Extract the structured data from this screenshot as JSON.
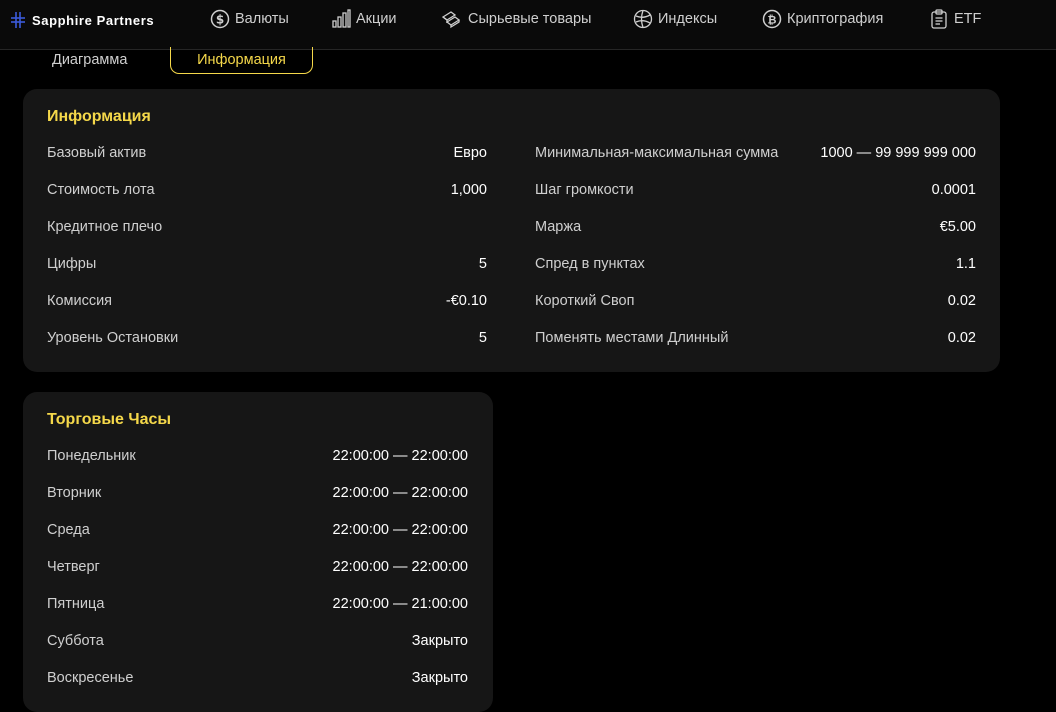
{
  "brand": {
    "name": "Sapphire Partners"
  },
  "nav": [
    {
      "label": "Валюты",
      "icon": "dollar-coin-icon"
    },
    {
      "label": "Акции",
      "icon": "bar-chart-icon"
    },
    {
      "label": "Сырьевые товары",
      "icon": "gold-bars-icon"
    },
    {
      "label": "Индексы",
      "icon": "globe-index-icon"
    },
    {
      "label": "Криптография",
      "icon": "bitcoin-icon"
    },
    {
      "label": "ETF",
      "icon": "clipboard-icon"
    }
  ],
  "subtabs": {
    "chart": "Диаграмма",
    "info": "Информация"
  },
  "info": {
    "title": "Информация",
    "left": [
      {
        "label": "Базовый актив",
        "value": "Евро"
      },
      {
        "label": "Стоимость лота",
        "value": "1,000"
      },
      {
        "label": "Кредитное плечо",
        "value": ""
      },
      {
        "label": "Цифры",
        "value": "5"
      },
      {
        "label": "Комиссия",
        "value": "-€0.10"
      },
      {
        "label": "Уровень Остановки",
        "value": "5"
      }
    ],
    "right": [
      {
        "label": "Минимальная-максимальная сумма",
        "value": "1000 — 99 999 999 000"
      },
      {
        "label": "Шаг громкости",
        "value": "0.0001"
      },
      {
        "label": "Маржа",
        "value": "€5.00"
      },
      {
        "label": "Спред в пунктах",
        "value": "1.1"
      },
      {
        "label": "Короткий Своп",
        "value": "0.02"
      },
      {
        "label": "Поменять местами Длинный",
        "value": "0.02"
      }
    ]
  },
  "hours": {
    "title": "Торговые Часы",
    "rows": [
      {
        "label": "Понедельник",
        "value": "22:00:00 — 22:00:00"
      },
      {
        "label": "Вторник",
        "value": "22:00:00 — 22:00:00"
      },
      {
        "label": "Среда",
        "value": "22:00:00 — 22:00:00"
      },
      {
        "label": "Четверг",
        "value": "22:00:00 — 22:00:00"
      },
      {
        "label": "Пятница",
        "value": "22:00:00 — 21:00:00"
      },
      {
        "label": "Суббота",
        "value": "Закрыто"
      },
      {
        "label": "Воскресенье",
        "value": "Закрыто"
      }
    ]
  },
  "colors": {
    "accent": "#f5d84a",
    "brand_mark": "#3b5bdb",
    "card_bg": "#161616"
  }
}
